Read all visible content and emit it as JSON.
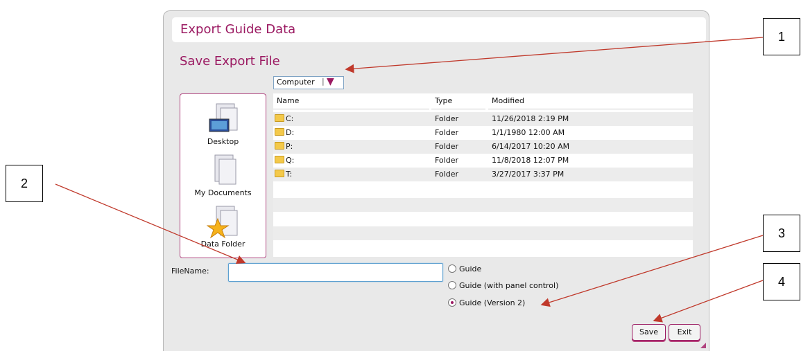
{
  "dialog": {
    "title": "Export Guide Data",
    "subtitle": "Save Export File",
    "location": "Computer"
  },
  "places": [
    {
      "label": "Desktop",
      "icon": "desktop-icon"
    },
    {
      "label": "My Documents",
      "icon": "documents-icon"
    },
    {
      "label": "Data Folder",
      "icon": "data-folder-icon"
    }
  ],
  "columns": {
    "name": "Name",
    "type": "Type",
    "modified": "Modified"
  },
  "files": [
    {
      "name": "C:",
      "type": "Folder",
      "modified": "11/26/2018 2:19 PM"
    },
    {
      "name": "D:",
      "type": "Folder",
      "modified": "1/1/1980 12:00 AM"
    },
    {
      "name": "P:",
      "type": "Folder",
      "modified": "6/14/2017 10:20 AM"
    },
    {
      "name": "Q:",
      "type": "Folder",
      "modified": "11/8/2018 12:07 PM"
    },
    {
      "name": "T:",
      "type": "Folder",
      "modified": "3/27/2017 3:37 PM"
    }
  ],
  "filename": {
    "label": "FileName:",
    "value": ""
  },
  "formats": [
    {
      "label": "Guide",
      "selected": false
    },
    {
      "label": "Guide (with panel control)",
      "selected": false
    },
    {
      "label": "Guide (Version 2)",
      "selected": true
    }
  ],
  "buttons": {
    "save": "Save",
    "exit": "Exit"
  },
  "callouts": [
    "1",
    "2",
    "3",
    "4"
  ],
  "colors": {
    "accent": "#9b1a62",
    "arrow": "#c0392b"
  }
}
